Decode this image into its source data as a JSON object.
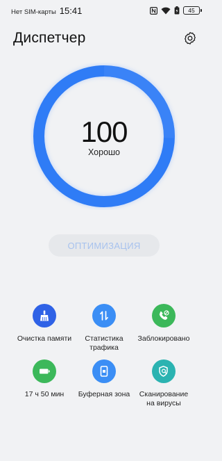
{
  "status_bar": {
    "carrier": "Нет SIM-карты",
    "time": "15:41",
    "battery": "45",
    "icons": [
      "nfc-icon",
      "wifi-icon",
      "battery-saver-icon",
      "battery-icon"
    ]
  },
  "header": {
    "title": "Диспетчер",
    "settings_icon": "gear-icon"
  },
  "score": {
    "value": "100",
    "label": "Хорошо",
    "progress": 1.0,
    "ring_color": "#2f7cf6"
  },
  "optimize_button": {
    "label": "ОПТИМИЗАЦИЯ"
  },
  "tools": [
    {
      "label": "Очистка памяти",
      "icon": "broom-icon",
      "color": "#2f62e6"
    },
    {
      "label": "Статистика\nтрафика",
      "icon": "traffic-arrows-icon",
      "color": "#3b8ef5"
    },
    {
      "label": "Заблокировано",
      "icon": "blocked-call-icon",
      "color": "#3cb85a"
    },
    {
      "label": "17 ч 50 мин",
      "icon": "battery-icon",
      "color": "#3cb85a"
    },
    {
      "label": "Буферная зона",
      "icon": "phone-buffer-icon",
      "color": "#3b8ef5"
    },
    {
      "label": "Сканирование\nна вирусы",
      "icon": "shield-scan-icon",
      "color": "#2bb3b1"
    }
  ]
}
